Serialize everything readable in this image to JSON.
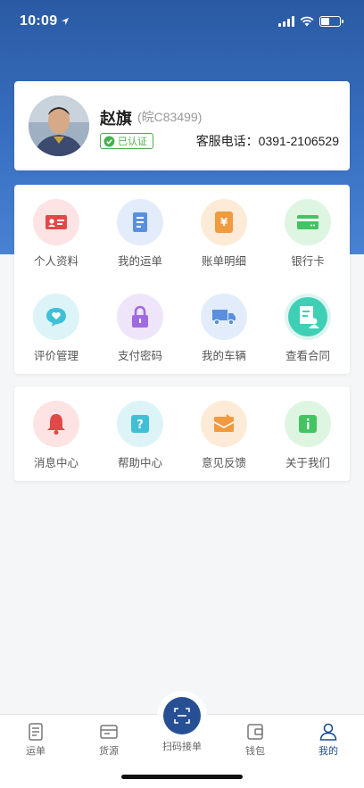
{
  "status_bar": {
    "time": "10:09"
  },
  "profile": {
    "name": "赵旗",
    "plate": "(皖C83499)",
    "verified": "已认证",
    "service_phone": "客服电话：0391-2106529"
  },
  "menu1": [
    {
      "label": "个人资料",
      "icon": "id-card-icon",
      "bg": "#fde3e3",
      "color": "#e24848"
    },
    {
      "label": "我的运单",
      "icon": "document-icon",
      "bg": "#e2ecfb",
      "color": "#5a8fe0"
    },
    {
      "label": "账单明细",
      "icon": "bill-icon",
      "bg": "#fdebd7",
      "color": "#f19a3e"
    },
    {
      "label": "银行卡",
      "icon": "bank-card-icon",
      "bg": "#def5e2",
      "color": "#43c463"
    },
    {
      "label": "评价管理",
      "icon": "chat-bubble-icon",
      "bg": "#dcf4f7",
      "color": "#3fc0d6"
    },
    {
      "label": "支付密码",
      "icon": "lock-icon",
      "bg": "#efe5fb",
      "color": "#a06be0"
    },
    {
      "label": "我的车辆",
      "icon": "truck-icon",
      "bg": "#e2ecfb",
      "color": "#5a8fe0"
    },
    {
      "label": "查看合同",
      "icon": "contract-icon",
      "bg": "#dcf5f1",
      "color": "#3fcfb5"
    }
  ],
  "menu2": [
    {
      "label": "消息中心",
      "icon": "bell-icon",
      "bg": "#fde3e3",
      "color": "#e24848"
    },
    {
      "label": "帮助中心",
      "icon": "help-icon",
      "bg": "#dcf4f7",
      "color": "#3fc0d6"
    },
    {
      "label": "意见反馈",
      "icon": "feedback-icon",
      "bg": "#fdebd7",
      "color": "#f19a3e"
    },
    {
      "label": "关于我们",
      "icon": "info-icon",
      "bg": "#def5e2",
      "color": "#43c463"
    }
  ],
  "tab_bar": {
    "waybill": "运单",
    "goods": "货源",
    "scan": "扫码接单",
    "wallet": "钱包",
    "mine": "我的"
  }
}
